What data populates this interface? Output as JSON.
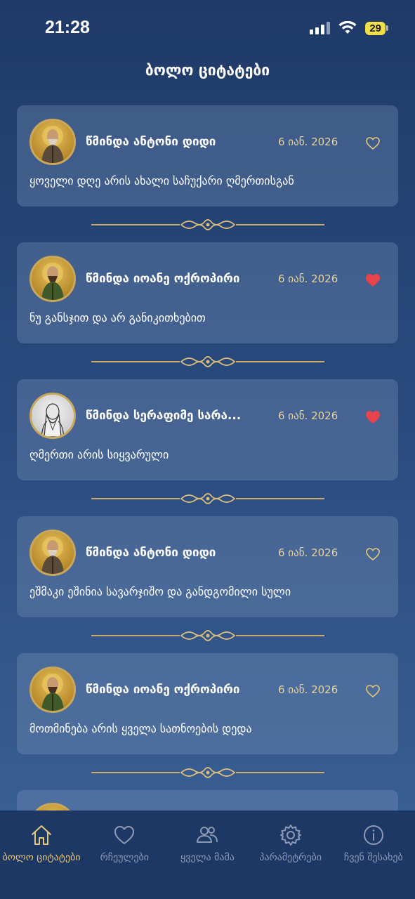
{
  "status": {
    "time": "21:28",
    "battery": "29"
  },
  "page": {
    "title": "ბოლო ციტატები"
  },
  "colors": {
    "accent_gold": "#e6c87a",
    "heart_active": "#e8424a",
    "card_bg": "rgba(120,145,185,0.35)"
  },
  "quotes": [
    {
      "saint": "წმინდა ანტონი დიდი",
      "date": "6 იან. 2026",
      "text": "ყოველი დღე არის ახალი საჩუქარი ღმერთისგან",
      "favorite": false,
      "icon": "saint-antony-portrait"
    },
    {
      "saint": "წმინდა იოანე ოქროპირი",
      "date": "6 იან. 2026",
      "text": "ნუ განსჯით და არ განიკითხებით",
      "favorite": true,
      "icon": "saint-john-chrysostom-portrait"
    },
    {
      "saint": "წმინდა სერაფიმე სარა...",
      "date": "6 იან. 2026",
      "text": "ღმერთი არის სიყვარული",
      "favorite": true,
      "icon": "saint-seraphim-portrait"
    },
    {
      "saint": "წმინდა ანტონი დიდი",
      "date": "6 იან. 2026",
      "text": "ეშმაკი ეშინია სავარჯიშო და განდგომილი სული",
      "favorite": false,
      "icon": "saint-antony-portrait"
    },
    {
      "saint": "წმინდა იოანე ოქროპირი",
      "date": "6 იან. 2026",
      "text": "მოთმინება არის ყველა სათნოების დედა",
      "favorite": false,
      "icon": "saint-john-chrysostom-portrait"
    }
  ],
  "tabs": [
    {
      "label": "ბოლო ციტატები",
      "icon": "home-icon",
      "active": true
    },
    {
      "label": "რჩეულები",
      "icon": "heart-icon",
      "active": false
    },
    {
      "label": "ყველა მამა",
      "icon": "people-icon",
      "active": false
    },
    {
      "label": "პარამეტრები",
      "icon": "gear-icon",
      "active": false
    },
    {
      "label": "ჩვენ შესახებ",
      "icon": "info-icon",
      "active": false
    }
  ]
}
